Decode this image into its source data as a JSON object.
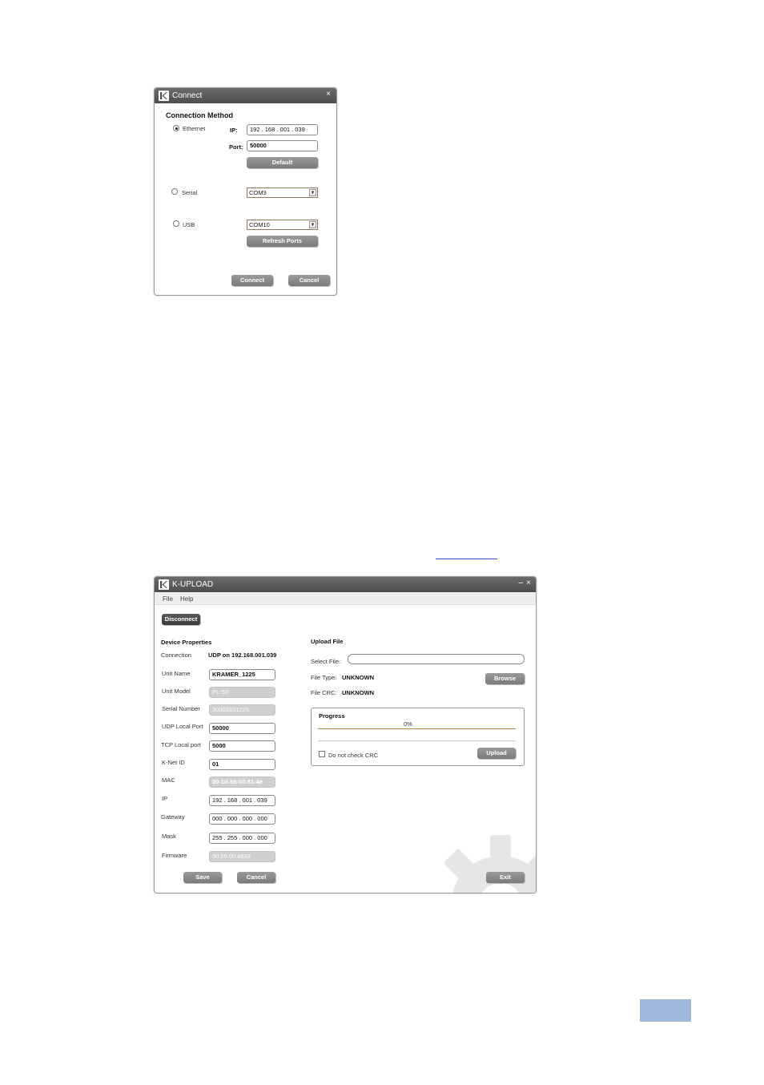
{
  "connect_dialog": {
    "title": "Connect",
    "close_glyph": "×",
    "section_title": "Connection Method",
    "ethernet": {
      "label": "Ethernet",
      "selected": true,
      "ip_label": "IP:",
      "ip_value": "192 . 168 . 001 . 039",
      "port_label": "Port:",
      "port_value": "50000",
      "default_button": "Default"
    },
    "serial": {
      "label": "Serial",
      "selected": false,
      "port_value": "COM3"
    },
    "usb": {
      "label": "USB",
      "selected": false,
      "port_value": "COM10",
      "refresh_button": "Refresh Ports"
    },
    "connect_button": "Connect",
    "cancel_button": "Cancel"
  },
  "kupload": {
    "title": "K-UPLOAD",
    "minimize_glyph": "–",
    "close_glyph": "×",
    "menu": [
      "File",
      "Help"
    ],
    "disconnect_button": "Disconnect",
    "device_properties": {
      "title": "Device Properties",
      "connection_label": "Connection",
      "connection_value": "UDP on 192.168.001.039",
      "fields": [
        {
          "label": "Unit Name",
          "value": "KRAMER_1225",
          "readonly": false
        },
        {
          "label": "Unit Model",
          "value": "PL-50",
          "readonly": true
        },
        {
          "label": "Serial Number",
          "value": "30003331225",
          "readonly": true
        },
        {
          "label": "UDP Local Port",
          "value": "50000",
          "readonly": false
        },
        {
          "label": "TCP Local port",
          "value": "5000",
          "readonly": false
        },
        {
          "label": "K-Net ID",
          "value": "01",
          "readonly": false
        },
        {
          "label": "MAC",
          "value": "00-1d-56-00-81-4e",
          "readonly": true
        },
        {
          "label": "IP",
          "value": "192 . 168 . 001 . 039",
          "readonly": false
        },
        {
          "label": "Gateway",
          "value": "000 . 000 . 000 . 000",
          "readonly": false
        },
        {
          "label": "Mask",
          "value": "255 . 255 . 000 . 000",
          "readonly": false
        },
        {
          "label": "Firmware",
          "value": "00.09.00.4633",
          "readonly": true
        }
      ],
      "save_button": "Save",
      "cancel_button": "Cancel"
    },
    "upload_file": {
      "title": "Upload File",
      "select_label": "Select File:",
      "select_value": "",
      "browse_button": "Browse",
      "file_type_label": "File Type:",
      "file_type_value": "UNKNOWN",
      "file_crc_label": "File CRC:",
      "file_crc_value": "UNKNOWN"
    },
    "progress": {
      "title": "Progress",
      "percent_text": "0%",
      "fraction": 0,
      "no_crc_label": "Do not check CRC",
      "no_crc_checked": false,
      "upload_button": "Upload"
    },
    "exit_button": "Exit",
    "gear_icon": "gear-watermark-icon"
  },
  "colors": {
    "titlebar": "#555555",
    "button": "#8a8a8a",
    "readonly_field": "#cfcfcf",
    "page_badge": "#9eb8dc",
    "link_underline": "#2a55c9"
  }
}
